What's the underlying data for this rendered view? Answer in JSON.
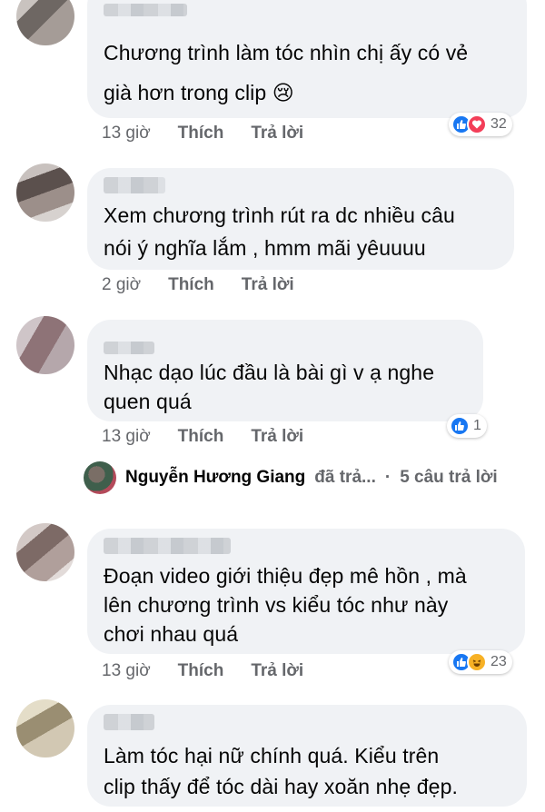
{
  "comments": [
    {
      "lines": [
        "Chương trình làm tóc nhìn chị ấy có vẻ",
        "già hơn trong clip 😢"
      ],
      "time": "13 giờ",
      "like_label": "Thích",
      "reply_label": "Trả lời",
      "reaction_icons": [
        "like-icon",
        "love-icon"
      ],
      "reaction_count": "32"
    },
    {
      "lines": [
        "Xem chương trình rút ra dc nhiều câu",
        "nói ý nghĩa lắm , hmm mãi yêuuuu"
      ],
      "time": "2 giờ",
      "like_label": "Thích",
      "reply_label": "Trả lời"
    },
    {
      "lines": [
        "Nhạc dạo lúc đầu là bài gì v ạ nghe",
        "quen quá"
      ],
      "time": "13 giờ",
      "like_label": "Thích",
      "reply_label": "Trả lời",
      "reaction_icons": [
        "like-icon"
      ],
      "reaction_count": "1"
    },
    {
      "lines": [
        "Đoạn video giới thiệu đẹp mê hồn , mà",
        "lên chương trình vs kiểu tóc như này",
        "chơi nhau quá"
      ],
      "time": "13 giờ",
      "like_label": "Thích",
      "reply_label": "Trả lời",
      "reaction_icons": [
        "like-icon",
        "haha-icon"
      ],
      "reaction_count": "23"
    },
    {
      "lines": [
        "Làm tóc hại nữ chính quá. Kiểu trên",
        "clip thấy để tóc dài hay xoăn nhẹ đẹp."
      ]
    }
  ],
  "reply_summary": {
    "name": "Nguyễn Hương Giang",
    "text": "đã trả...",
    "separator": "·",
    "count_text": "5 câu trả lời"
  },
  "colors": {
    "bubble": "#f0f2f5",
    "meta_text": "#65676b",
    "like_blue": "#1877f2",
    "love_red": "#f33e58",
    "haha_yellow": "#f7b125"
  }
}
